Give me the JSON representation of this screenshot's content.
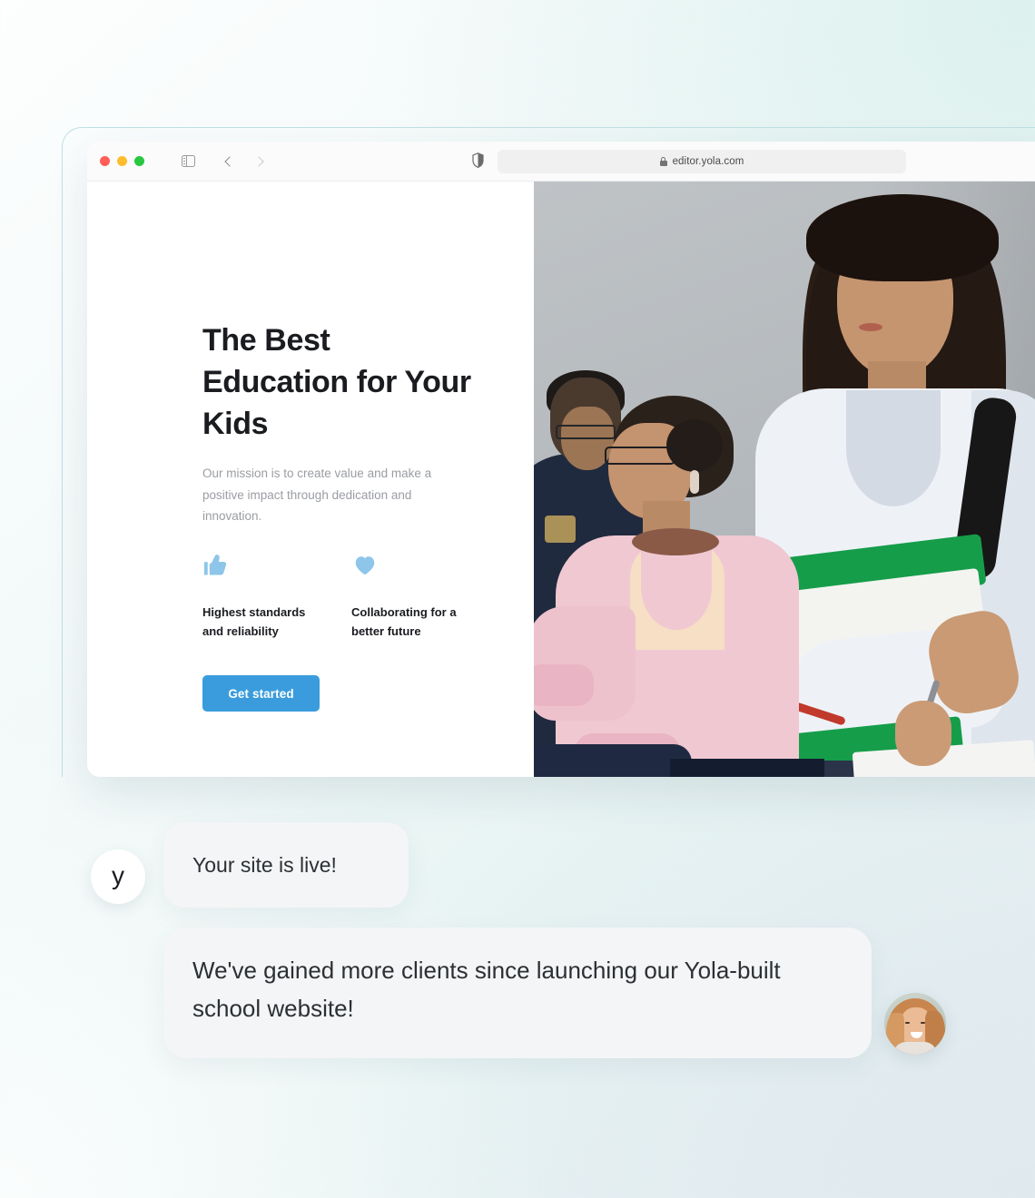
{
  "browser": {
    "traffic_lights": [
      {
        "name": "close",
        "color": "#ff5f57"
      },
      {
        "name": "minimize",
        "color": "#febc2e"
      },
      {
        "name": "maximize",
        "color": "#28c840"
      }
    ],
    "sidebar_icon": "sidebar-toggle-icon",
    "back_icon": "back-chevron-icon",
    "forward_icon": "forward-chevron-icon",
    "shield_icon": "privacy-shield-icon",
    "lock_icon": "lock-icon",
    "url": "editor.yola.com",
    "reload_icon": "reload-icon"
  },
  "site": {
    "headline": "The Best Education for Your Kids",
    "paragraph": "Our mission is to create value and make a positive impact through dedication and innovation.",
    "features": [
      {
        "icon": "thumbs-up-icon",
        "label": "Highest standards and reliability"
      },
      {
        "icon": "heart-icon",
        "label": "Collaborating for a better future"
      }
    ],
    "cta_label": "Get started",
    "hero_image_alt": "Students in a classroom"
  },
  "chat": {
    "brand_avatar_letter": "y",
    "messages": [
      {
        "sender": "yola",
        "text": "Your site is live!"
      },
      {
        "sender": "user",
        "text": "We've gained more clients since launching our Yola-built school website!"
      }
    ],
    "user_avatar_alt": "Smiling woman portrait"
  },
  "colors": {
    "accent_blue": "#3a9cdc",
    "icon_blue": "#8ec6ea",
    "heading": "#1a1c20",
    "body_text": "#9a9da2",
    "bubble_bg": "#f4f5f6"
  }
}
